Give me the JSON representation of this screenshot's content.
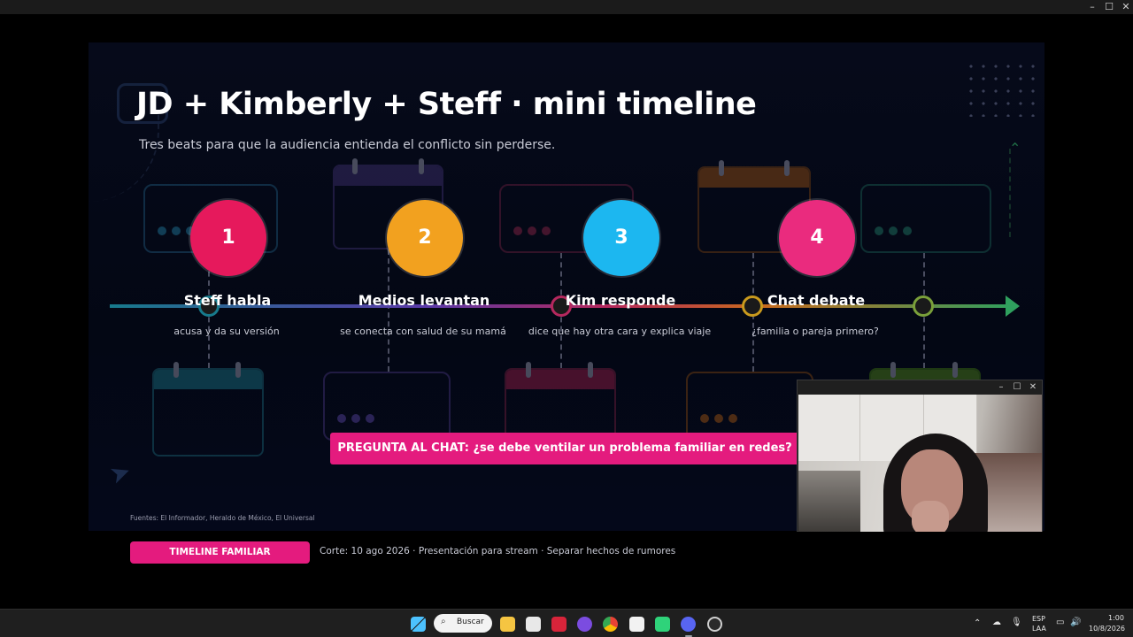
{
  "window": {
    "minimize_icon": "minimize-icon",
    "maximize_icon": "maximize-icon",
    "close_icon": "close-icon",
    "minimize_glyph": "–",
    "maximize_glyph": "☐",
    "close_glyph": "✕"
  },
  "slide": {
    "title": "JD + Kimberly + Steff · mini timeline",
    "subtitle": "Tres beats para que la audiencia entienda el conflicto sin perderse.",
    "beats": [
      {
        "number": "1",
        "title": "Steff habla",
        "description": "acusa y da su versión",
        "color": "#e6195c",
        "node_color": "#177a8c"
      },
      {
        "number": "2",
        "title": "Medios levantan",
        "description": "se conecta con salud de su mamá",
        "color": "#f2a11f",
        "node_color": "#5a3aa8"
      },
      {
        "number": "3",
        "title": "Kim responde",
        "description": "dice que hay otra cara y explica viaje",
        "color": "#1cb7f0",
        "node_color": "#b5285e"
      },
      {
        "number": "4",
        "title": "Chat debate",
        "description": "¿familia o pareja primero?",
        "color": "#ea2b7e",
        "node_color": "#c96a1d"
      }
    ],
    "question": "PREGUNTA AL CHAT: ¿se debe ventilar un problema familiar en redes?",
    "sources": "Fuentes: El Informador, Heraldo de México, El Universal"
  },
  "footer": {
    "badge": "TIMELINE FAMILIAR",
    "meta": "Corte: 10 ago 2026  ·  Presentación para stream  ·  Separar hechos de rumores"
  },
  "webcam": {
    "minimize_glyph": "–",
    "maximize_glyph": "☐",
    "close_glyph": "✕"
  },
  "taskbar": {
    "search_label": "Buscar",
    "language_top": "ESP",
    "language_bottom": "LAA",
    "time": "1:00",
    "date": "10/8/2026",
    "icons": [
      "windows-start-icon",
      "search-icon",
      "file-explorer-icon",
      "tool-icon",
      "acrobat-icon",
      "purple-app-icon",
      "chrome-icon",
      "chart-app-icon",
      "green-app-icon",
      "discord-icon",
      "settings-icon"
    ]
  },
  "colors": {
    "accent_pink": "#e41b7e",
    "background": "#000000",
    "slide_background": "#060a1a"
  }
}
